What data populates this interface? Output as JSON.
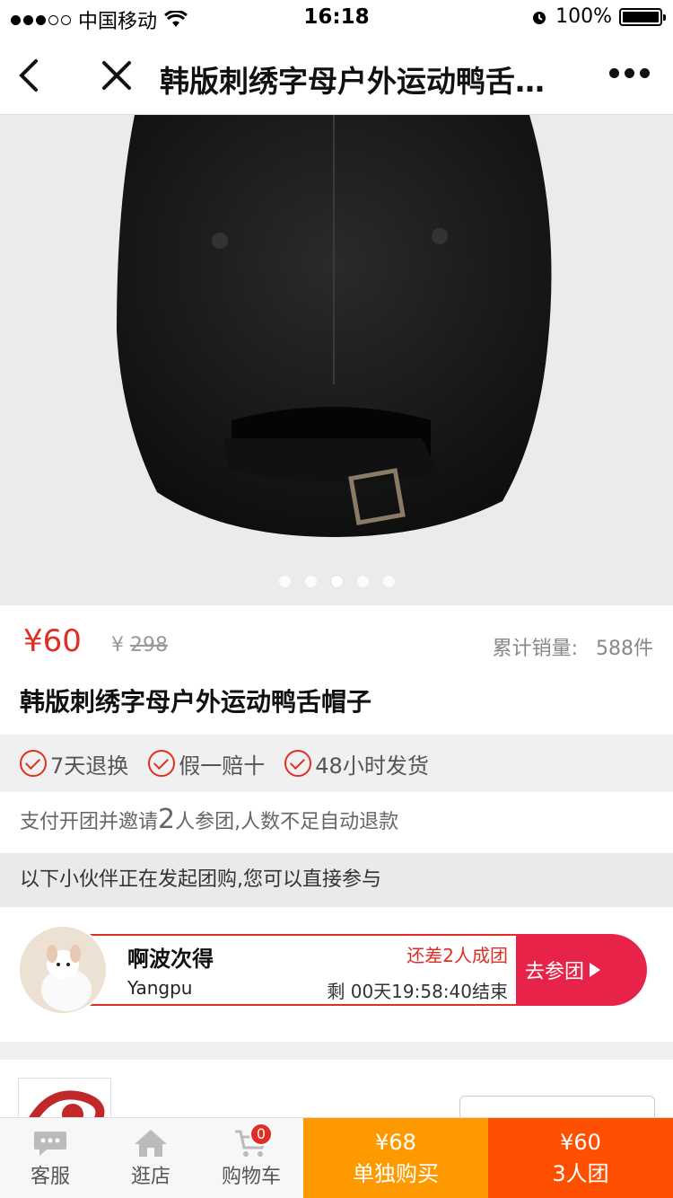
{
  "status_bar": {
    "carrier": "中国移动",
    "time": "16:18",
    "battery": "100%"
  },
  "nav": {
    "title": "韩版刺绣字母户外运动鸭舌帽子"
  },
  "hero": {
    "icon": "black-baseball-cap-photo",
    "slide_count": 5,
    "active_slide": 3
  },
  "product": {
    "price": "¥60",
    "original_currency": "¥",
    "original_price": "298",
    "sales_label": "累计销量:",
    "sales_value": "588件",
    "name": "韩版刺绣字母户外运动鸭舌帽子"
  },
  "guarantees": [
    {
      "label": "7天退换"
    },
    {
      "label": "假一赔十"
    },
    {
      "label": "48小时发货"
    }
  ],
  "invite": {
    "prefix": "支付开团并邀请",
    "count": "2",
    "suffix": "人参团,人数不足自动退款"
  },
  "group_header": "以下小伙伴正在发起团购,您可以直接参与",
  "group": {
    "name": "啊波次得",
    "location": "Yangpu",
    "need": "还差2人成团",
    "time_left": "剩 00天19:58:40结束",
    "join_label": "去参团"
  },
  "bottom": {
    "tabs": [
      {
        "label": "客服",
        "icon": "chat-icon"
      },
      {
        "label": "逛店",
        "icon": "home-icon"
      },
      {
        "label": "购物车",
        "icon": "cart-icon",
        "badge": "0"
      }
    ],
    "solo_price": "¥68",
    "solo_label": "单独购买",
    "group_price": "¥60",
    "group_label": "3人团"
  },
  "colors": {
    "accent": "#e02e24",
    "solo": "#ff9900",
    "group": "#ff4f00",
    "join": "#e8234a"
  }
}
